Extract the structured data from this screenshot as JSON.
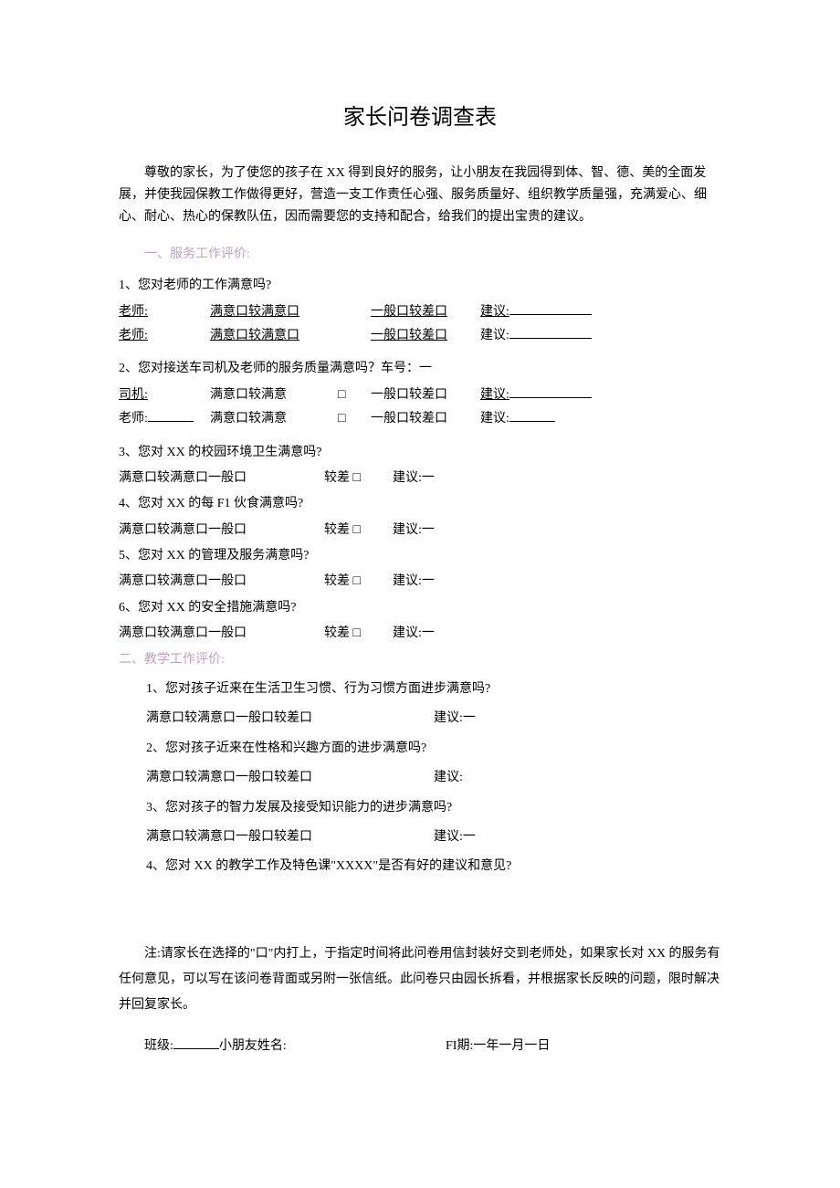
{
  "title": "家长问卷调查表",
  "intro": "尊敬的家长，为了使您的孩子在 XX 得到良好的服务，让小朋友在我园得到体、智、德、美的全面发展，并使我园保教工作做得更好，营造一支工作责任心强、服务质量好、组织教学质量强，充满爱心、细心、耐心、热心的保教队伍，因而需要您的支持和配合，给我们的提出宝贵的建议。",
  "section1": {
    "header": "一、服务工作评价:",
    "q1": "1、您对老师的工作满意吗?",
    "teacher_label": "老师:",
    "driver_label": "司机:",
    "opt_a": "满意口较满意口",
    "opt_a2": "满意口较满意",
    "opt_b": "一般口较差口",
    "box": "□",
    "suggest_u": "建议:",
    "q2": "2、您对接送车司机及老师的服务质量满意吗？车号：一",
    "q3": "3、您对 XX 的校园环境卫生满意吗?",
    "q4": "4、您对 XX 的每 F1 伙食满意吗?",
    "q5": "5、您对 XX 的管理及服务满意吗?",
    "q6": "6、您对 XX 的安全措施满意吗?",
    "rating_a": "满意口较满意口一般口",
    "rating_b": "较差 □",
    "rating_c": "建议:一"
  },
  "section2": {
    "header": "二、教学工作评价:",
    "q1": "1、您对孩子近来在生活卫生习惯、行为习惯方面进步满意吗?",
    "q2": "2、您对孩子近来在性格和兴趣方面的进步满意吗?",
    "q3": "3、您对孩子的智力发展及接受知识能力的进步满意吗?",
    "q4": "4、您对 XX 的教学工作及特色课\"XXXX\"是否有好的建议和意见?",
    "rating_full": "满意口较满意口一般口较差口",
    "suggest_dash": "建议:一",
    "suggest_plain": "建议:"
  },
  "footer": {
    "note": "注:请家长在选择的\"口\"内打上，于指定时间将此问卷用信封装好交到老师处，如果家长对 XX 的服务有任何意见，可以写在该问卷背面或另附一张信纸。此问卷只由园长拆看，并根据家长反映的问题，限时解决并回复家长。",
    "class_label": "班级:",
    "name_label": "小朋友姓名:",
    "date_label": "FI期:一年一月一日"
  }
}
